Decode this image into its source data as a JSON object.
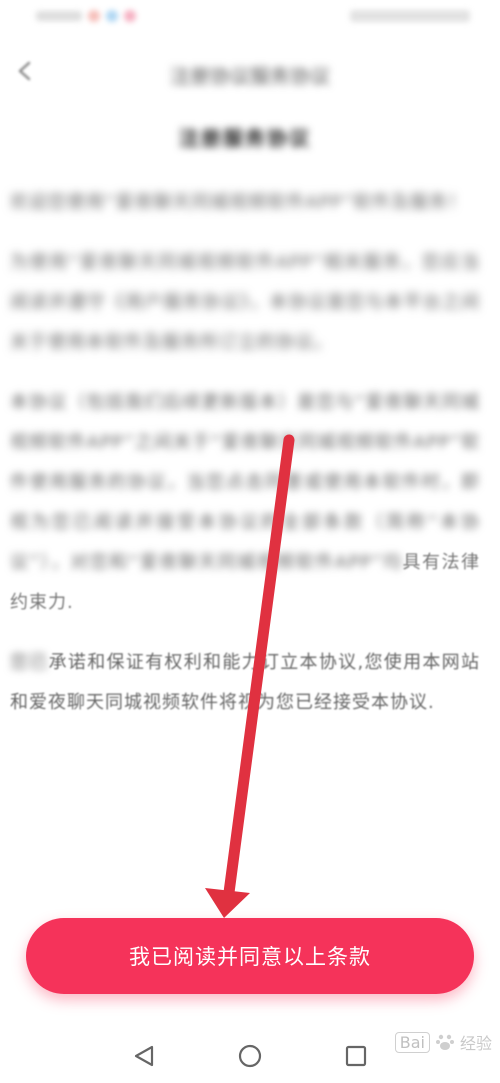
{
  "status_bar": {
    "left_colors": [
      "#f2a39c",
      "#8ec6ee",
      "#f28fa8"
    ]
  },
  "header": {
    "title": "注册协议服务协议"
  },
  "document": {
    "title": "注册服务协议",
    "paragraph_1": "欢迎您使用“爱夜聊天同城视频软件APP”软件及服务！",
    "paragraph_2": "为使用“爱夜聊天同城视频软件APP”相关服务，您应当阅读并遵守《用户服务协议》，本协议是您与本平台之间关于使用本软件及服务所订立的协议。",
    "paragraph_3_blurred": "本协议（包括我们后续更新版本）是您与“爱夜聊天同城视频软件APP”之间关于“爱夜聊天同城视频软件APP”软件使用服务的协议，当您点击同意或使用本软件时，即视为您已阅读并接受本协议的全部条款（简称“本协议”），对您和“爱夜聊天同城视频软件APP”均",
    "paragraph_3_visible": "具有法律约束力.",
    "paragraph_4_lead": "您已",
    "paragraph_4_text": "承诺和保证有权利和能力订立本协议,您使用本网站和爱夜聊天同城视频软件将视为您已经接受本协议."
  },
  "agree_button": {
    "label": "我已阅读并同意以上条款",
    "color": "#f5335a"
  },
  "annotation": {
    "arrow_color": "#e03140"
  },
  "nav_bar": {
    "back": "back-triangle",
    "home": "home-circle",
    "recents": "recents-square"
  },
  "watermark": {
    "brand": "Bai",
    "brand_suffix": "经验"
  }
}
